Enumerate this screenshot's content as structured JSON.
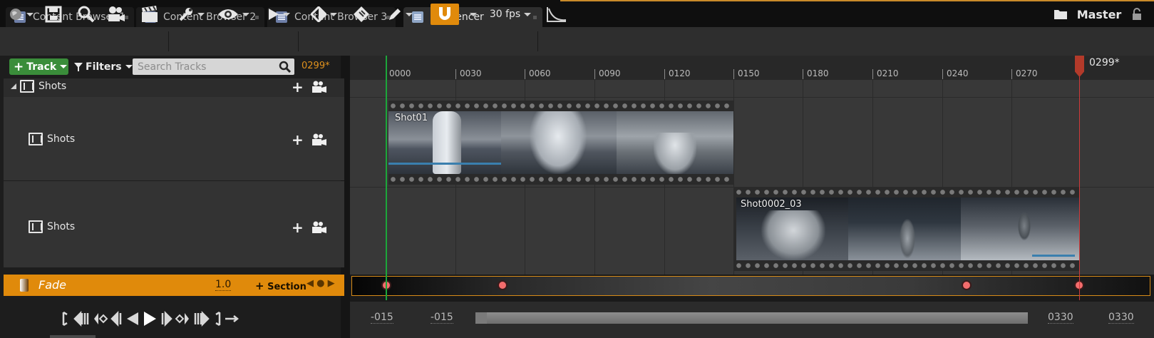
{
  "tabs": [
    {
      "label": "Content Browser 1",
      "icon": "content-browser-icon"
    },
    {
      "label": "Content Browser 2",
      "icon": "content-browser-icon"
    },
    {
      "label": "Content Browser 3",
      "icon": "content-browser-icon"
    },
    {
      "label": "Sequencer",
      "icon": "sequencer-icon",
      "active": true
    }
  ],
  "toolbar": {
    "fps": "30 fps",
    "master_label": "Master",
    "icons": [
      "world-icon",
      "save-icon",
      "search-icon",
      "camera-icon",
      "clapper-icon",
      "wrench-icon",
      "eye-icon",
      "play-icon",
      "keyframe-icon",
      "key-tag-icon",
      "pencil-icon",
      "magnet-icon",
      "curve-editor-icon",
      "folder-icon",
      "lock-icon"
    ],
    "accent": "#e08a0b"
  },
  "track_panel": {
    "add_track_label": "Track",
    "filters_label": "Filters",
    "search_placeholder": "Search Tracks",
    "current_frame": "0299*",
    "tracks": [
      {
        "name": "Shots"
      },
      {
        "name": "Shots"
      },
      {
        "name": "Shots"
      }
    ],
    "fade": {
      "name": "Fade",
      "value": "1.0",
      "section_label": "Section"
    }
  },
  "ruler": {
    "ticks": [
      "0000",
      "0030",
      "0060",
      "0090",
      "0120",
      "0150",
      "0180",
      "0210",
      "0240",
      "0270"
    ],
    "playhead_label": "0299*"
  },
  "shots": [
    {
      "name": "Shot01"
    },
    {
      "name": "Shot0002_03"
    }
  ],
  "range": {
    "view_start": "-015",
    "play_start": "-015",
    "play_end": "0330",
    "view_end": "0330"
  },
  "colors": {
    "start_marker": "#1ca63a",
    "end_marker": "#d03a3a",
    "key": "#f46c6c",
    "add_track_button": "#3a8d3a"
  }
}
